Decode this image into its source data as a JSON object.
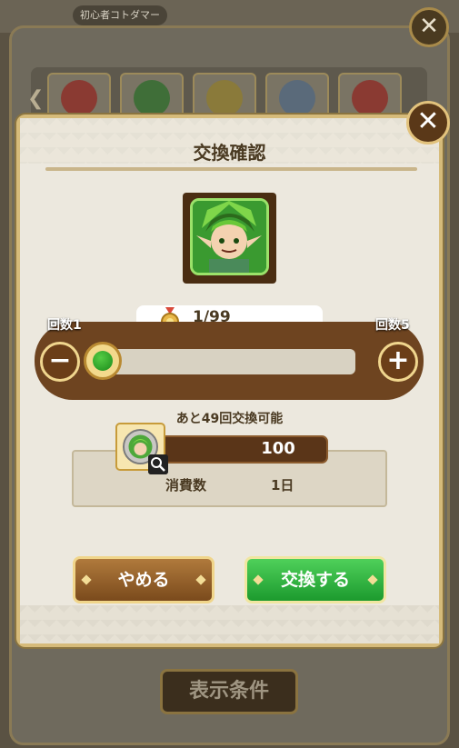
{
  "background": {
    "chip_label": "初心者コトダマー",
    "filter_button": "表示条件",
    "close_label": "✕",
    "scroll_arrow": "❮"
  },
  "dialog": {
    "title": "交換確認",
    "close_label": "✕",
    "counter": {
      "current": "1/99",
      "min_label": "回数1",
      "max_label": "回数5",
      "minus_label": "−",
      "plus_label": "+",
      "slider_value": 1,
      "slider_min": 1,
      "slider_max": 5
    },
    "remaining_text": "あと49回交換可能",
    "cost": {
      "value": "100",
      "label": "消費数",
      "count": "1日"
    },
    "buttons": {
      "cancel": "やめる",
      "exchange": "交換する"
    }
  },
  "colors": {
    "accent_gold": "#d6bb7a",
    "exchange_green": "#1c9a2e",
    "cancel_brown": "#7a4a1c",
    "slider_band": "#6e4420"
  },
  "icons": [
    "medal-icon",
    "zoom-icon",
    "close-icon",
    "minus-icon",
    "plus-icon"
  ]
}
